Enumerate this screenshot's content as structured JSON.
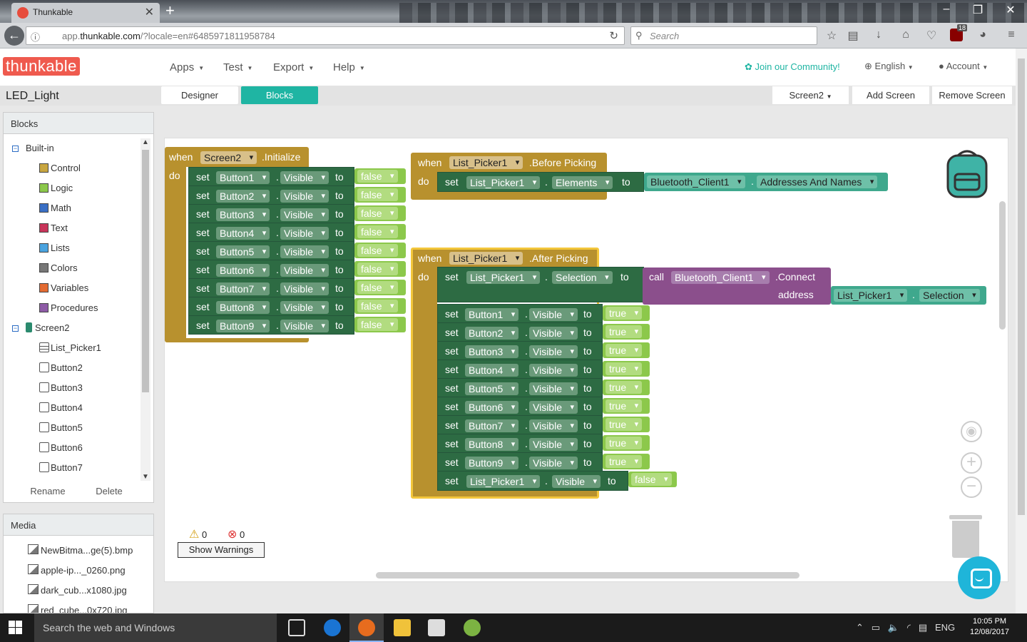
{
  "browser": {
    "tab_title": "Thunkable",
    "url_prefix": "app.",
    "url_domain": "thunkable.com",
    "url_rest": "/?locale=en#6485971811958784",
    "search_placeholder": "Search",
    "ublock_count": "18"
  },
  "header": {
    "logo": "thunkable",
    "menu": [
      {
        "label": "Apps"
      },
      {
        "label": "Test"
      },
      {
        "label": "Export"
      },
      {
        "label": "Help"
      }
    ],
    "community": "Join our Community!",
    "language": "English",
    "account": "Account"
  },
  "subbar": {
    "project_name": "LED_Light",
    "designer": "Designer",
    "blocks": "Blocks",
    "screen_select": "Screen2",
    "add_screen": "Add Screen",
    "remove_screen": "Remove Screen"
  },
  "blocks_panel": {
    "title": "Blocks",
    "builtin": "Built-in",
    "categories": [
      {
        "label": "Control",
        "color": "#c8a640"
      },
      {
        "label": "Logic",
        "color": "#8cc84b"
      },
      {
        "label": "Math",
        "color": "#3a6fc4"
      },
      {
        "label": "Text",
        "color": "#c8355a"
      },
      {
        "label": "Lists",
        "color": "#4aa3df"
      },
      {
        "label": "Colors",
        "color": "#777777"
      },
      {
        "label": "Variables",
        "color": "#e36b33"
      },
      {
        "label": "Procedures",
        "color": "#8e5ba6"
      }
    ],
    "screen": "Screen2",
    "components": [
      "List_Picker1",
      "Button2",
      "Button3",
      "Button4",
      "Button5",
      "Button6",
      "Button7"
    ],
    "rename": "Rename",
    "delete": "Delete"
  },
  "media_panel": {
    "title": "Media",
    "items": [
      "NewBitma...ge(5).bmp",
      "apple-ip..._0260.png",
      "dark_cub...x1080.jpg",
      "red_cube...0x720.jpg"
    ]
  },
  "workspace": {
    "kw_when": "when",
    "kw_do": "do",
    "kw_set": "set",
    "kw_to": "to",
    "kw_call": "call",
    "kw_address": "address",
    "dot": ".",
    "init_event": {
      "component": "Screen2",
      "event": ".Initialize",
      "rows": [
        {
          "comp": "Button1",
          "prop": "Visible",
          "value": "false"
        },
        {
          "comp": "Button2",
          "prop": "Visible",
          "value": "false"
        },
        {
          "comp": "Button3",
          "prop": "Visible",
          "value": "false"
        },
        {
          "comp": "Button4",
          "prop": "Visible",
          "value": "false"
        },
        {
          "comp": "Button5",
          "prop": "Visible",
          "value": "false"
        },
        {
          "comp": "Button6",
          "prop": "Visible",
          "value": "false"
        },
        {
          "comp": "Button7",
          "prop": "Visible",
          "value": "false"
        },
        {
          "comp": "Button8",
          "prop": "Visible",
          "value": "false"
        },
        {
          "comp": "Button9",
          "prop": "Visible",
          "value": "false"
        }
      ]
    },
    "before_event": {
      "component": "List_Picker1",
      "event": ".Before Picking",
      "set_comp": "List_Picker1",
      "set_prop": "Elements",
      "value_comp": "Bluetooth_Client1",
      "value_prop": "Addresses And Names"
    },
    "after_event": {
      "component": "List_Picker1",
      "event": ".After Picking",
      "set_comp": "List_Picker1",
      "set_prop": "Selection",
      "call_comp": "Bluetooth_Client1",
      "call_method": ".Connect",
      "arg_comp": "List_Picker1",
      "arg_prop": "Selection",
      "rows": [
        {
          "comp": "Button1",
          "prop": "Visible",
          "value": "true"
        },
        {
          "comp": "Button2",
          "prop": "Visible",
          "value": "true"
        },
        {
          "comp": "Button3",
          "prop": "Visible",
          "value": "true"
        },
        {
          "comp": "Button4",
          "prop": "Visible",
          "value": "true"
        },
        {
          "comp": "Button5",
          "prop": "Visible",
          "value": "true"
        },
        {
          "comp": "Button6",
          "prop": "Visible",
          "value": "true"
        },
        {
          "comp": "Button7",
          "prop": "Visible",
          "value": "true"
        },
        {
          "comp": "Button8",
          "prop": "Visible",
          "value": "true"
        },
        {
          "comp": "Button9",
          "prop": "Visible",
          "value": "true"
        }
      ],
      "last": {
        "comp": "List_Picker1",
        "prop": "Visible",
        "value": "false"
      }
    },
    "warning_count": "0",
    "error_count": "0",
    "show_warnings": "Show Warnings"
  },
  "taskbar": {
    "search": "Search the web and Windows",
    "lang": "ENG",
    "time": "10:05 PM",
    "date": "12/08/2017"
  }
}
